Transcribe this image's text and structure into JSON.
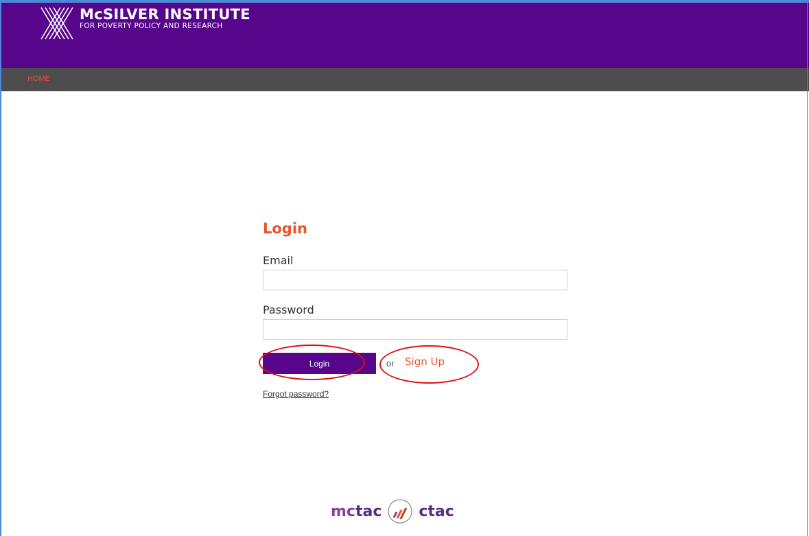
{
  "header": {
    "logo_title": "McSILVER INSTITUTE",
    "logo_subtitle": "FOR POVERTY POLICY AND RESEARCH",
    "logo_icon": "mcsilver-logo-icon",
    "brand_color": "#57068c"
  },
  "nav": {
    "items": [
      {
        "label": "HOME",
        "color": "#e84b3c"
      }
    ],
    "background": "#4d4d4d"
  },
  "login": {
    "title": "Login",
    "email_label": "Email",
    "email_value": "",
    "password_label": "Password",
    "password_value": "",
    "login_button": "Login",
    "or_text": "or",
    "signup_link": "Sign Up",
    "forgot_link": "Forgot password?",
    "accent_color": "#e8542b"
  },
  "footer": {
    "brand_left_prefix": "mc",
    "brand_left_rest": "tac",
    "brand_icon": "tac-logo-icon",
    "brand_right": "ctac"
  },
  "annotations": {
    "color": "#e01010"
  }
}
